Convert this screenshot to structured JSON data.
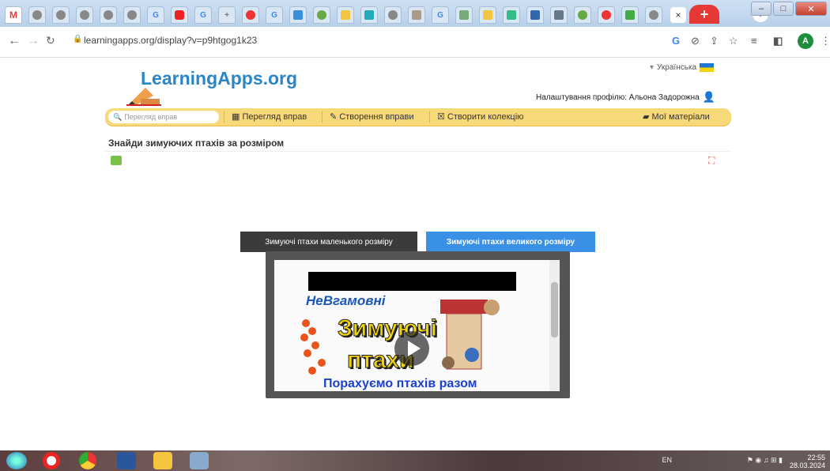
{
  "browser": {
    "url": "learningapps.org/display?v=p9htgog1k23",
    "new_tab_label": "+",
    "close_tab_label": "×",
    "avatar_letter": "A"
  },
  "header": {
    "logo_text": "LearningApps.org",
    "language": "Українська",
    "profile_settings": "Налаштування профілю: Альона Задорожна"
  },
  "navbar": {
    "search_placeholder": "Перегляд вправ",
    "browse_label": "Перегляд вправ",
    "create_label": "Створення вправи",
    "collection_label": "Створити колекцію",
    "materials_label": "Мої матеріали"
  },
  "page": {
    "title": "Знайди зимуючих птахів за розміром"
  },
  "app": {
    "tabs": [
      {
        "label": "Зимуючі птахи маленького розміру"
      },
      {
        "label": "Зимуючі птахи великого розміру"
      }
    ],
    "video": {
      "channel_text": "НеВгамовні",
      "title_line1": "Зимуючі",
      "title_line2": "птахи",
      "subtitle": "Порахуємо птахів разом"
    }
  },
  "taskbar": {
    "lang": "EN",
    "time": "22:55",
    "date": "28.03.2024"
  }
}
